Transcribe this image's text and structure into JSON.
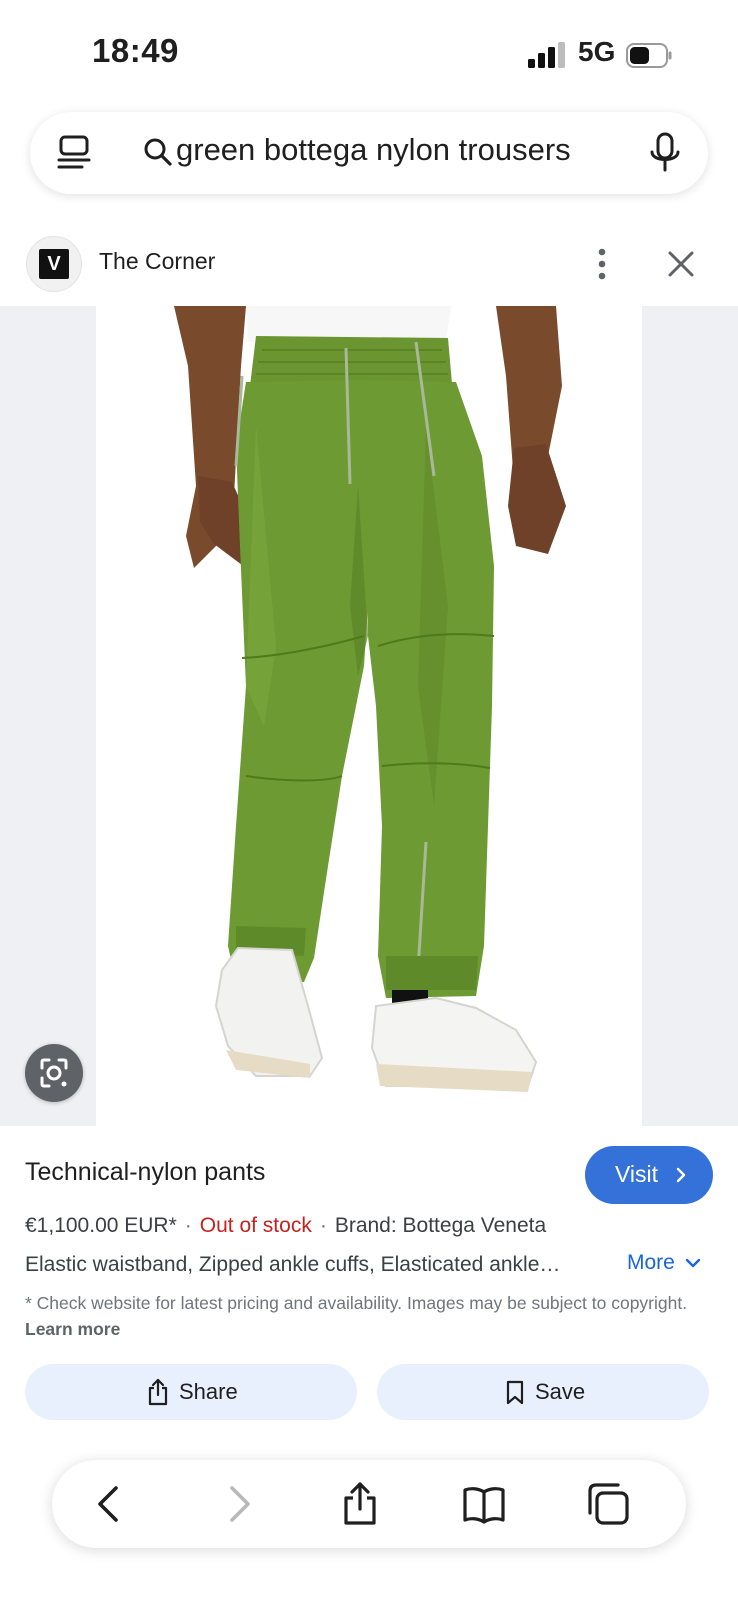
{
  "status_bar": {
    "time": "18:49",
    "network": "5G"
  },
  "search": {
    "query": "green bottega nylon trousers"
  },
  "source": {
    "name": "The Corner",
    "logo_text": "V"
  },
  "product": {
    "title": "Technical-nylon pants",
    "visit_label": "Visit",
    "price": "€1,100.00 EUR*",
    "separator": "·",
    "stock_status": "Out of stock",
    "brand": "Brand: Bottega Veneta",
    "features": "Elastic waistband, Zipped ankle cuffs, Elasticated ankle…",
    "more_label": "More",
    "disclaimer": "* Check website for latest pricing and availability. Images may be subject to copyright.",
    "learn_more": "Learn more",
    "color": "#6e9a34"
  },
  "actions": {
    "share_label": "Share",
    "save_label": "Save"
  },
  "colors": {
    "accent": "#3471d8",
    "out_of_stock": "#c5221f",
    "action_bg": "#e8effd",
    "link": "#1a65d8"
  }
}
